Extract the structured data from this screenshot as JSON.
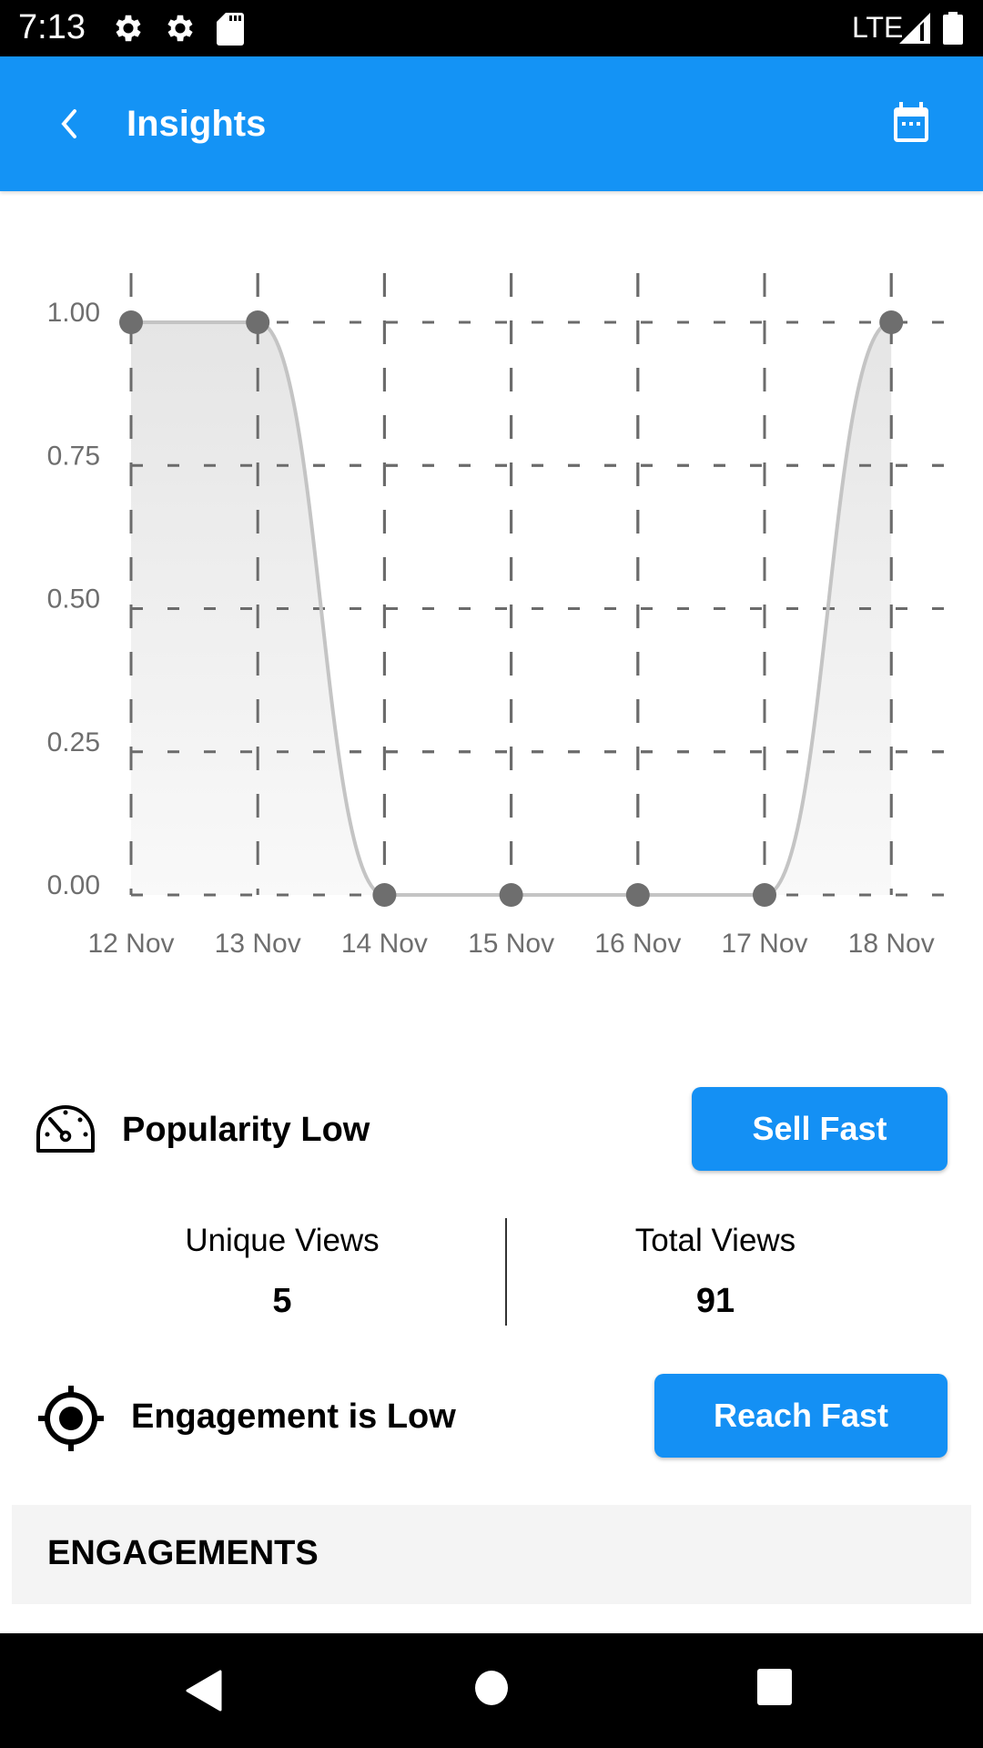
{
  "status_bar": {
    "time": "7:13",
    "left_icons": [
      "settings-icon",
      "settings-icon",
      "sd-card-icon"
    ],
    "network": "LTE",
    "right_icons": [
      "signal-icon",
      "battery-icon"
    ]
  },
  "app_bar": {
    "title": "Insights",
    "back_icon": "arrow-back-icon",
    "action_icon": "calendar-icon",
    "color": "#1493f5"
  },
  "chart_data": {
    "type": "line",
    "style": "smooth area",
    "categories": [
      "12 Nov",
      "13 Nov",
      "14 Nov",
      "15 Nov",
      "16 Nov",
      "17 Nov",
      "18 Nov"
    ],
    "values": [
      1,
      1,
      0,
      0,
      0,
      0,
      1
    ],
    "y_tick_labels": [
      "0.00",
      "0.25",
      "0.50",
      "0.75",
      "1.00"
    ],
    "y_ticks": [
      0,
      0.25,
      0.5,
      0.75,
      1
    ],
    "ylim": [
      0,
      1
    ],
    "title": "",
    "xlabel": "",
    "ylabel": "",
    "grid": true,
    "grid_style": "dashed",
    "legend": "none",
    "line_color": "#c4c4c4",
    "marker_color": "#6e6e6e"
  },
  "popularity": {
    "icon": "speedometer-icon",
    "label": "Popularity Low",
    "button_label": "Sell Fast"
  },
  "stats": {
    "unique_views_label": "Unique Views",
    "unique_views_value": "5",
    "total_views_label": "Total Views",
    "total_views_value": "91"
  },
  "engagement": {
    "icon": "target-icon",
    "label": "Engagement is Low",
    "button_label": "Reach Fast"
  },
  "section": {
    "title": "ENGAGEMENTS"
  },
  "nav_bar": {
    "icons": [
      "nav-back-icon",
      "nav-home-icon",
      "nav-recents-icon"
    ]
  }
}
